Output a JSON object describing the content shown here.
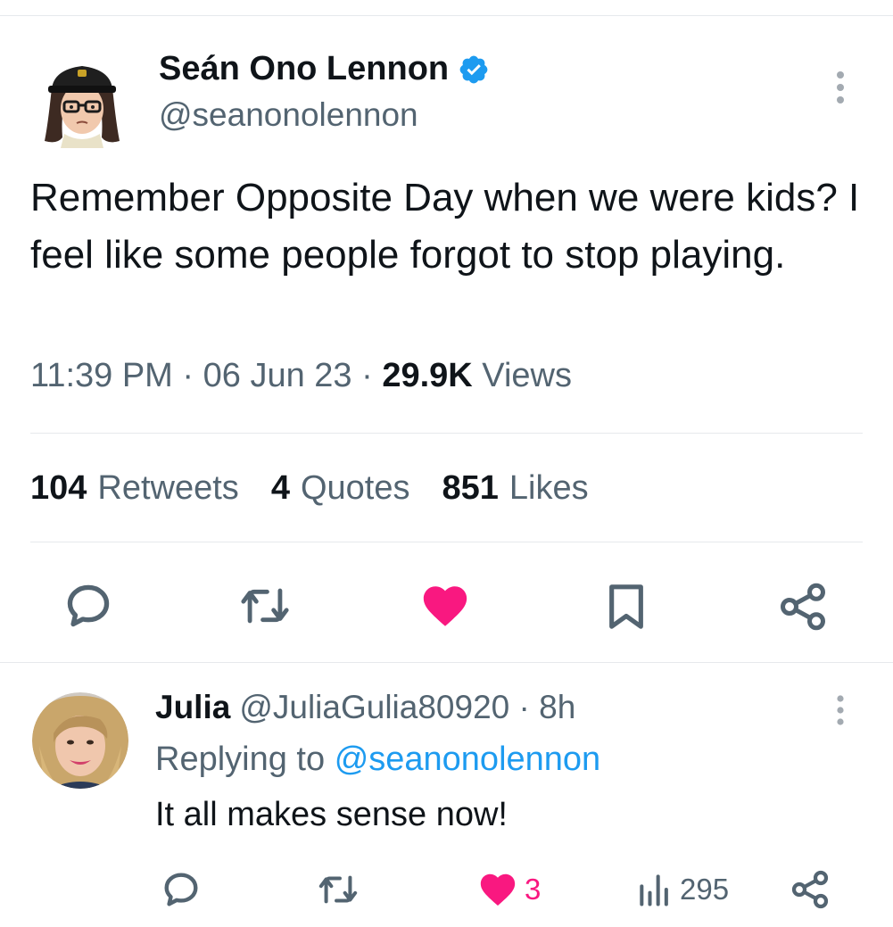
{
  "main_tweet": {
    "author_name": "Seán Ono Lennon",
    "handle": "@seanonolennon",
    "text": "Remember Opposite Day when we were kids? I feel like some people forgot to stop playing.",
    "time": "11:39 PM",
    "separator": "·",
    "date": "06 Jun 23",
    "views_count": "29.9K",
    "views_label": "Views",
    "stats": {
      "retweets_count": "104",
      "retweets_label": "Retweets",
      "quotes_count": "4",
      "quotes_label": "Quotes",
      "likes_count": "851",
      "likes_label": "Likes"
    },
    "icons": {
      "verified": "verified-badge-icon",
      "more": "more-options-icon",
      "reply": "reply-icon",
      "retweet": "retweet-icon",
      "like": "heart-icon",
      "bookmark": "bookmark-icon",
      "share": "share-icon"
    },
    "liked": true
  },
  "reply": {
    "author_name": "Julia",
    "handle": "@JuliaGulia80920",
    "separator": "·",
    "time_ago": "8h",
    "replying_prefix": "Replying to",
    "replying_to": "@seanonolennon",
    "text": "It all makes sense now!",
    "likes_count": "3",
    "views_count": "295",
    "liked": true
  },
  "colors": {
    "text_primary": "#0f1419",
    "text_secondary": "#536471",
    "accent_blue": "#1d9bf0",
    "like_pink": "#f91880",
    "divider": "#e6e9ec"
  }
}
